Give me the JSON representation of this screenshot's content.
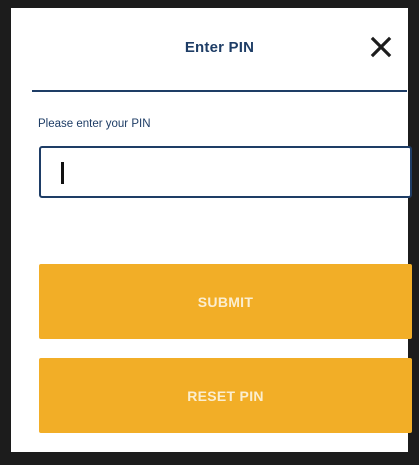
{
  "dialog": {
    "title": "Enter PIN",
    "close_icon": "close-icon",
    "prompt": "Please enter your PIN",
    "pin_value": "",
    "submit_label": "SUBMIT",
    "reset_label": "RESET PIN"
  },
  "colors": {
    "accent": "#f2ae27",
    "text": "#1e3d66",
    "button_text": "#fbeed0"
  }
}
